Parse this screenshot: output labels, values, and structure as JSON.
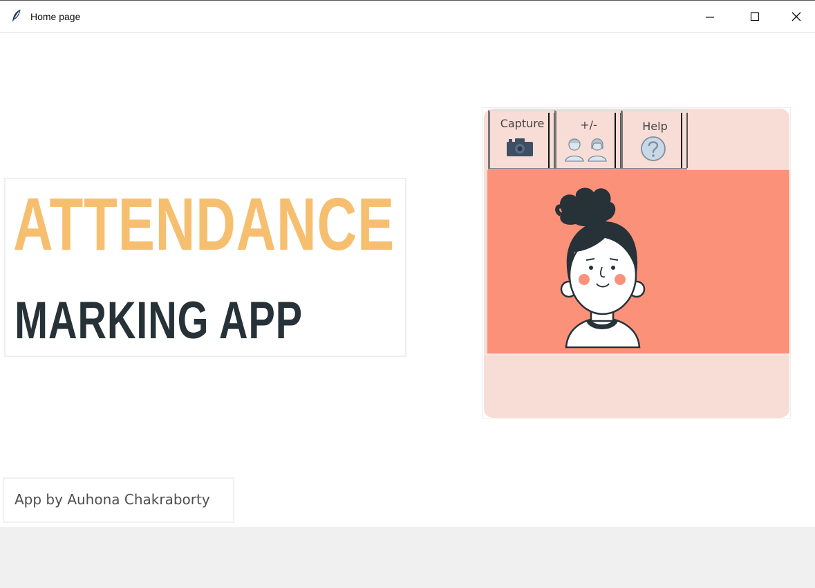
{
  "window": {
    "title": "Home page",
    "icon": "feather-icon"
  },
  "controls": {
    "minimize": "minimize-icon",
    "maximize": "maximize-icon",
    "close": "close-icon"
  },
  "heading": {
    "line1": "ATTENDANCE",
    "line2": "MARKING APP"
  },
  "toolbar": {
    "capture_label": "Capture",
    "manage_label": "+/-",
    "help_label": "Help"
  },
  "credit": {
    "text": "App by Auhona Chakraborty"
  },
  "colors": {
    "title_orange": "#f6bf6f",
    "title_dark": "#263238",
    "card_bg": "#f8ddd7",
    "photo_bg": "#fc9179"
  }
}
